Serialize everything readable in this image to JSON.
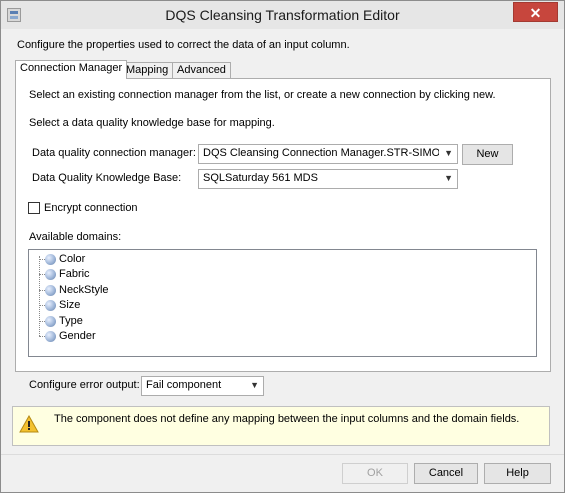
{
  "window": {
    "title": "DQS Cleansing Transformation Editor",
    "close_glyph": "✕"
  },
  "description": "Configure the properties used to correct the data of an input column.",
  "tabs": [
    {
      "label": "Connection Manager",
      "active": true
    },
    {
      "label": "Mapping",
      "active": false
    },
    {
      "label": "Advanced",
      "active": false
    }
  ],
  "panel": {
    "intro_line1": "Select an existing connection manager from the list, or create a new connection by clicking new.",
    "intro_line2": "Select a data quality knowledge base for mapping.",
    "connection_label": "Data quality connection manager:",
    "connection_value": "DQS Cleansing Connection Manager.STR-SIMON\\St",
    "new_button": "New",
    "kb_label": "Data Quality Knowledge Base:",
    "kb_value": "SQLSaturday 561 MDS",
    "encrypt_label": "Encrypt connection",
    "encrypt_checked": false,
    "domains_label": "Available domains:",
    "domains": [
      "Color",
      "Fabric",
      "NeckStyle",
      "Size",
      "Type",
      "Gender"
    ]
  },
  "error_output": {
    "label": "Configure error output:",
    "value": "Fail component"
  },
  "message": {
    "icon": "warning-icon",
    "text": "The component does not define any mapping between the input columns and the domain fields."
  },
  "buttons": {
    "ok": "OK",
    "cancel": "Cancel",
    "help": "Help"
  }
}
